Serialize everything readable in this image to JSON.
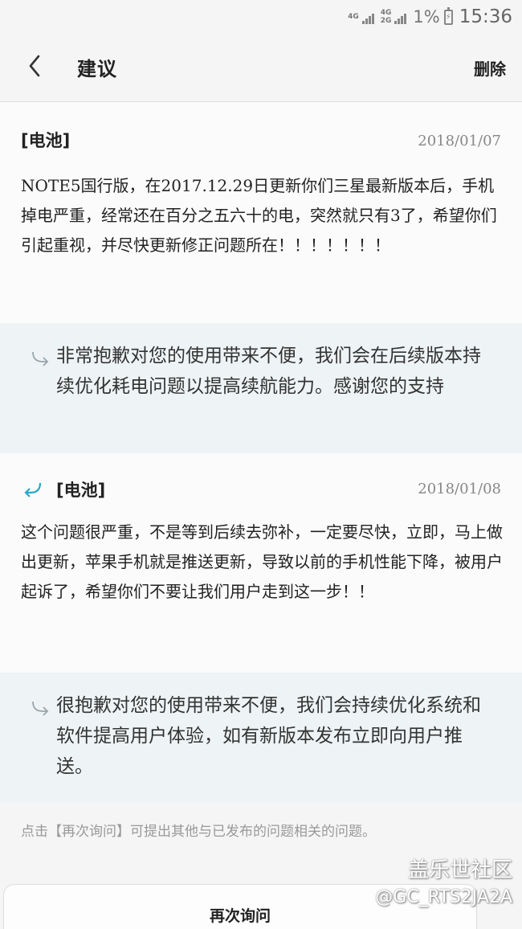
{
  "status_bar": {
    "network_top": "4G",
    "network_mid": "4G",
    "network_bot": "2G",
    "battery_percent": "1%",
    "time": "15:36"
  },
  "header": {
    "title": "建议",
    "delete_label": "删除",
    "back_icon": "chevron-left-icon"
  },
  "threads": [
    {
      "tag": "[电池]",
      "date": "2018/01/07",
      "body": "NOTE5国行版，在2017.12.29日更新你们三星最新版本后，手机掉电严重，经常还在百分之五六十的电，突然就只有3了，希望你们引起重视，并尽快更新修正问题所在！！！！！！！",
      "reply": "非常抱歉对您的使用带来不便，我们会在后续版本持续优化耗电问题以提高续航能力。感谢您的支持"
    },
    {
      "tag": "[电池]",
      "date": "2018/01/08",
      "body": "这个问题很严重，不是等到后续去弥补，一定要尽快，立即，马上做出更新，苹果手机就是推送更新，导致以前的手机性能下降，被用户起诉了，希望你们不要让我们用户走到这一步！！",
      "reply": "很抱歉对您的使用带来不便，我们会持续优化系统和软件提高用户体验，如有新版本发布立即向用户推送。"
    }
  ],
  "hint": "点击【再次询问】可提出其他与已发布的问题相关的问题。",
  "ask_again_label": "再次询问",
  "watermark": {
    "line1": "盖乐世社区",
    "line2": "@GC_RTS2JA2A"
  },
  "colors": {
    "accent": "#2aa9c9",
    "answer_bg": "#eef3f5",
    "page_bg": "#f5f5f5"
  }
}
